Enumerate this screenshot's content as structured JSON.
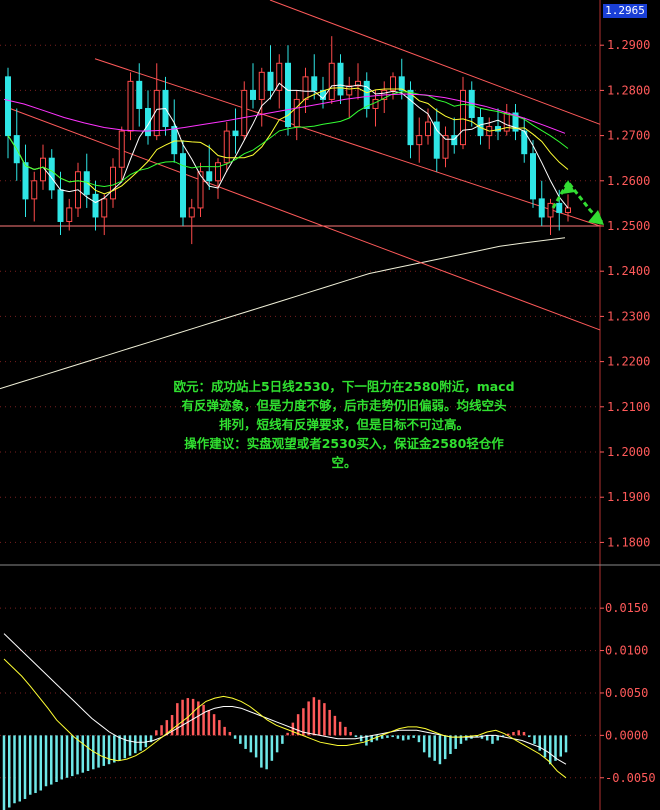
{
  "current_price": "1.2965",
  "commentary": [
    "欧元：成功站上5日线2530，下一阻力在2580附近，macd",
    "有反弹迹象，但是力度不够，后市走势仍旧偏弱。均线空头",
    "排列，短线有反弹要求，但是目标不可过高。",
    "操作建议：实盘观望或者2530买入，保证金2580轻仓作",
    "空。"
  ],
  "colors": {
    "background": "#000000",
    "up_candle": "#ff4a4a",
    "down_candle": "#2fe6e6",
    "ma5": "#ffffff",
    "ma10": "#ffff33",
    "ma20": "#33ff33",
    "ma60": "#ff33ff",
    "ma200": "#f0f0d8",
    "channel": "#ff5a5a",
    "support": "#ff7a7a",
    "arrow": "#33dd33",
    "axis_text": "#ff5a5a"
  },
  "chart_data": [
    {
      "type": "candlestick",
      "ylim": [
        1.175,
        1.3
      ],
      "y_ticks": [
        "1.2900",
        "1.2800",
        "1.2700",
        "1.2600",
        "1.2500",
        "1.2400",
        "1.2300",
        "1.2200",
        "1.2100",
        "1.2000",
        "1.1900",
        "1.1800"
      ],
      "candles": [
        [
          1.283,
          1.285,
          1.265,
          1.27
        ],
        [
          1.27,
          1.276,
          1.26,
          1.264
        ],
        [
          1.264,
          1.268,
          1.252,
          1.256
        ],
        [
          1.256,
          1.262,
          1.251,
          1.26
        ],
        [
          1.26,
          1.268,
          1.258,
          1.265
        ],
        [
          1.265,
          1.267,
          1.256,
          1.258
        ],
        [
          1.258,
          1.262,
          1.248,
          1.251
        ],
        [
          1.251,
          1.256,
          1.249,
          1.254
        ],
        [
          1.254,
          1.264,
          1.252,
          1.262
        ],
        [
          1.262,
          1.266,
          1.254,
          1.257
        ],
        [
          1.257,
          1.26,
          1.249,
          1.252
        ],
        [
          1.252,
          1.257,
          1.248,
          1.256
        ],
        [
          1.256,
          1.265,
          1.254,
          1.263
        ],
        [
          1.263,
          1.272,
          1.26,
          1.271
        ],
        [
          1.271,
          1.284,
          1.269,
          1.282
        ],
        [
          1.282,
          1.286,
          1.272,
          1.276
        ],
        [
          1.276,
          1.28,
          1.268,
          1.27
        ],
        [
          1.27,
          1.286,
          1.269,
          1.28
        ],
        [
          1.28,
          1.283,
          1.27,
          1.272
        ],
        [
          1.272,
          1.278,
          1.264,
          1.266
        ],
        [
          1.266,
          1.269,
          1.25,
          1.252
        ],
        [
          1.252,
          1.256,
          1.246,
          1.254
        ],
        [
          1.254,
          1.264,
          1.252,
          1.262
        ],
        [
          1.262,
          1.268,
          1.258,
          1.26
        ],
        [
          1.26,
          1.265,
          1.256,
          1.264
        ],
        [
          1.264,
          1.273,
          1.262,
          1.271
        ],
        [
          1.271,
          1.276,
          1.266,
          1.27
        ],
        [
          1.27,
          1.282,
          1.269,
          1.28
        ],
        [
          1.28,
          1.286,
          1.276,
          1.278
        ],
        [
          1.278,
          1.285,
          1.272,
          1.284
        ],
        [
          1.284,
          1.29,
          1.278,
          1.28
        ],
        [
          1.28,
          1.288,
          1.276,
          1.286
        ],
        [
          1.286,
          1.29,
          1.27,
          1.272
        ],
        [
          1.272,
          1.28,
          1.269,
          1.278
        ],
        [
          1.278,
          1.285,
          1.275,
          1.283
        ],
        [
          1.283,
          1.288,
          1.278,
          1.28
        ],
        [
          1.28,
          1.283,
          1.276,
          1.278
        ],
        [
          1.278,
          1.292,
          1.277,
          1.286
        ],
        [
          1.286,
          1.288,
          1.277,
          1.279
        ],
        [
          1.279,
          1.283,
          1.274,
          1.281
        ],
        [
          1.281,
          1.286,
          1.278,
          1.282
        ],
        [
          1.282,
          1.284,
          1.274,
          1.276
        ],
        [
          1.276,
          1.28,
          1.272,
          1.278
        ],
        [
          1.278,
          1.282,
          1.275,
          1.28
        ],
        [
          1.28,
          1.284,
          1.278,
          1.283
        ],
        [
          1.283,
          1.287,
          1.278,
          1.28
        ],
        [
          1.28,
          1.282,
          1.265,
          1.268
        ],
        [
          1.268,
          1.274,
          1.264,
          1.27
        ],
        [
          1.27,
          1.276,
          1.268,
          1.273
        ],
        [
          1.273,
          1.276,
          1.262,
          1.265
        ],
        [
          1.265,
          1.272,
          1.263,
          1.27
        ],
        [
          1.27,
          1.274,
          1.266,
          1.268
        ],
        [
          1.268,
          1.283,
          1.267,
          1.28
        ],
        [
          1.28,
          1.282,
          1.272,
          1.274
        ],
        [
          1.274,
          1.276,
          1.268,
          1.27
        ],
        [
          1.27,
          1.274,
          1.267,
          1.272
        ],
        [
          1.272,
          1.276,
          1.269,
          1.271
        ],
        [
          1.271,
          1.277,
          1.27,
          1.275
        ],
        [
          1.275,
          1.277,
          1.269,
          1.271
        ],
        [
          1.271,
          1.274,
          1.264,
          1.266
        ],
        [
          1.266,
          1.269,
          1.254,
          1.256
        ],
        [
          1.256,
          1.26,
          1.25,
          1.252
        ],
        [
          1.252,
          1.256,
          1.248,
          1.255
        ],
        [
          1.255,
          1.258,
          1.249,
          1.253
        ],
        [
          1.253,
          1.257,
          1.251,
          1.254
        ]
      ],
      "moving_averages": [
        {
          "name": "MA200",
          "start": 0,
          "values": [
            1.214,
            1.2155,
            1.217,
            1.2185,
            1.22,
            1.2215,
            1.223,
            1.2245,
            1.226,
            1.2275,
            1.229,
            1.2305,
            1.232,
            1.2335,
            1.235,
            1.2365,
            1.238,
            1.2395,
            1.2405,
            1.2415,
            1.2425,
            1.2435,
            1.2445,
            1.2455,
            1.2462,
            1.2468,
            1.2474
          ]
        },
        {
          "name": "MA60",
          "start": 0,
          "values": [
            1.278,
            1.277,
            1.2755,
            1.274,
            1.2728,
            1.2718,
            1.2712,
            1.271,
            1.2712,
            1.2718,
            1.2725,
            1.2732,
            1.274,
            1.2748,
            1.2756,
            1.2764,
            1.2772,
            1.278,
            1.2786,
            1.279,
            1.2792,
            1.279,
            1.2784,
            1.2775,
            1.2765,
            1.2752,
            1.2738,
            1.2722,
            1.2705
          ]
        }
      ]
    },
    {
      "type": "bar",
      "name": "MACD",
      "ylim": [
        -0.0088,
        0.0195
      ],
      "y_ticks": [
        "0.0150",
        "0.0100",
        "0.0050",
        "0.0000",
        "-0.0050"
      ],
      "hist": [
        -0.009,
        -0.0085,
        -0.008,
        -0.0078,
        -0.0075,
        -0.007,
        -0.0068,
        -0.0065,
        -0.006,
        -0.0058,
        -0.0055,
        -0.0052,
        -0.005,
        -0.0048,
        -0.0046,
        -0.0044,
        -0.0042,
        -0.004,
        -0.0038,
        -0.0036,
        -0.0034,
        -0.0032,
        -0.003,
        -0.0027,
        -0.0024,
        -0.0021,
        -0.0018,
        -0.0014,
        -0.0008,
        0.0006,
        0.0012,
        0.0018,
        0.0024,
        0.0038,
        0.0042,
        0.0044,
        0.0043,
        0.004,
        0.0036,
        0.003,
        0.0025,
        0.0018,
        0.001,
        0.0004,
        -0.0004,
        -0.001,
        -0.0016,
        -0.002,
        -0.0026,
        -0.0038,
        -0.004,
        -0.003,
        -0.002,
        -0.001,
        0.0003,
        0.0015,
        0.0025,
        0.0032,
        0.004,
        0.0045,
        0.0042,
        0.0038,
        0.003,
        0.0023,
        0.0016,
        0.001,
        0.0004,
        -0.0002,
        -0.0007,
        -0.0012,
        -0.0008,
        -0.0006,
        -0.0004,
        -0.0003,
        -0.0002,
        -0.0004,
        -0.0006,
        -0.0005,
        -0.0003,
        -0.0008,
        -0.002,
        -0.0026,
        -0.003,
        -0.0034,
        -0.0028,
        -0.0022,
        -0.0016,
        -0.001,
        -0.0006,
        -0.0004,
        -0.0002,
        -0.0004,
        -0.0006,
        -0.001,
        -0.0006,
        -0.0002,
        0.0002,
        0.0004,
        0.0006,
        0.0004,
        -0.0002,
        -0.001,
        -0.0018,
        -0.0026,
        -0.0034,
        -0.003,
        -0.0025,
        -0.002
      ],
      "dif": [
        0.009,
        0.008,
        0.007,
        0.0058,
        0.0045,
        0.0032,
        0.0018,
        0.0008,
        -0.0002,
        -0.001,
        -0.0018,
        -0.0024,
        -0.0028,
        -0.003,
        -0.0028,
        -0.0024,
        -0.0018,
        -0.001,
        -0.0002,
        0.0006,
        0.0014,
        0.0022,
        0.0032,
        0.004,
        0.0044,
        0.0046,
        0.0044,
        0.004,
        0.0034,
        0.0026,
        0.0018,
        0.0012,
        0.0008,
        0.0004,
        0.0,
        -0.0004,
        -0.0008,
        -0.001,
        -0.0012,
        -0.0012,
        -0.001,
        -0.0008,
        -0.0004,
        0.0,
        0.0004,
        0.0008,
        0.001,
        0.001,
        0.0008,
        0.0004,
        0.0,
        -0.0002,
        -0.0002,
        -0.0001,
        0.0,
        0.0004,
        0.0006,
        0.0002,
        -0.0004,
        -0.001,
        -0.0016,
        -0.0022,
        -0.003,
        -0.0042,
        -0.005
      ],
      "dea": [
        0.012,
        0.011,
        0.01,
        0.009,
        0.008,
        0.007,
        0.006,
        0.005,
        0.004,
        0.003,
        0.002,
        0.0012,
        0.0004,
        -0.0002,
        -0.0006,
        -0.0008,
        -0.0008,
        -0.0006,
        -0.0002,
        0.0004,
        0.001,
        0.0016,
        0.0022,
        0.0028,
        0.0032,
        0.0034,
        0.0034,
        0.0032,
        0.0028,
        0.0024,
        0.002,
        0.0016,
        0.0012,
        0.0008,
        0.0004,
        0.0002,
        0.0,
        -0.0002,
        -0.0004,
        -0.0004,
        -0.0004,
        -0.0002,
        0.0,
        0.0002,
        0.0004,
        0.0006,
        0.0006,
        0.0006,
        0.0004,
        0.0002,
        0.0,
        -0.0002,
        -0.0002,
        -0.0002,
        -0.0002,
        0.0,
        0.0,
        -0.0002,
        -0.0004,
        -0.0006,
        -0.001,
        -0.0014,
        -0.002,
        -0.0028,
        -0.0034
      ]
    }
  ]
}
